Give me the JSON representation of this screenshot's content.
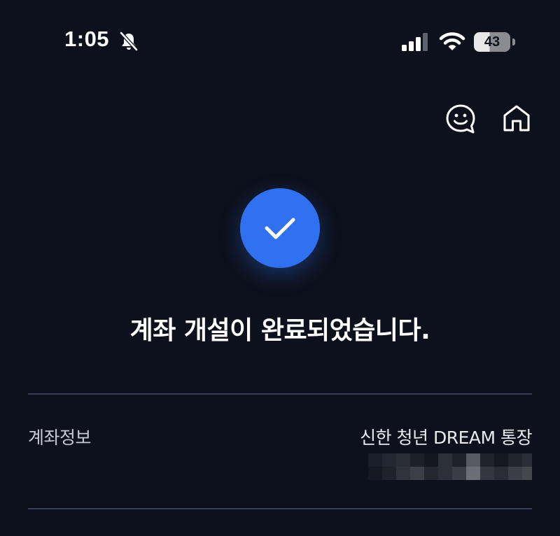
{
  "status_bar": {
    "time": "1:05",
    "battery_level": "43",
    "battery_fraction": 0.43,
    "silent_mode": true,
    "icons": [
      "bell-slash-icon",
      "cellular-signal-icon",
      "wifi-icon",
      "battery-icon"
    ]
  },
  "header": {
    "actions": [
      {
        "icon": "chatbot-icon"
      },
      {
        "icon": "home-icon"
      }
    ]
  },
  "result": {
    "icon": "check-icon",
    "title": "계좌 개설이 완료되었습니다."
  },
  "account_info": {
    "label": "계좌정보",
    "account_name": "신한 청년 DREAM 통장",
    "account_number_masked": true
  },
  "colors": {
    "background": "#0d111c",
    "accent": "#2f71f0",
    "divider": "#363d52",
    "text_primary": "#ffffff",
    "text_secondary": "#c6c9d1"
  }
}
